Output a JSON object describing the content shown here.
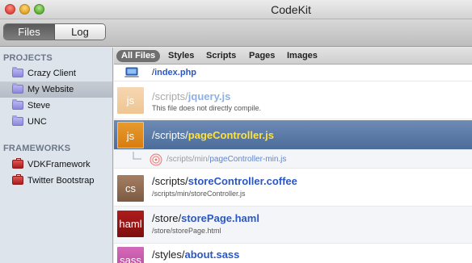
{
  "window": {
    "title": "CodeKit"
  },
  "toolbar": {
    "tabs": [
      "Files",
      "Log"
    ],
    "active_tab": "Files"
  },
  "sidebar": {
    "projects_heading": "PROJECTS",
    "projects": [
      "Crazy Client",
      "My Website",
      "Steve",
      "UNC"
    ],
    "selected_project": "My Website",
    "frameworks_heading": "FRAMEWORKS",
    "frameworks": [
      "VDKFramework",
      "Twitter Bootstrap"
    ]
  },
  "filters": {
    "items": [
      "All Files",
      "Styles",
      "Scripts",
      "Pages",
      "Images"
    ],
    "active": "All Files"
  },
  "files": [
    {
      "dir": "/",
      "name": "index.php",
      "sub": "",
      "icon": "computer-icon"
    },
    {
      "dir": "/scripts/",
      "name": "jquery.js",
      "sub": "This file does not directly compile.",
      "icon": "js",
      "tile": "js"
    },
    {
      "dir": "/scripts/",
      "name": "pageController.js",
      "sub": "",
      "icon": "js",
      "tile": "js",
      "selected": true
    },
    {
      "dir": "/scripts/min/",
      "name": "pageController-min.js",
      "sub": "",
      "icon": "target-icon"
    },
    {
      "dir": "/scripts/",
      "name": "storeController.coffee",
      "sub": "/scripts/min/storeController.js",
      "icon": "cs",
      "tile": "cs"
    },
    {
      "dir": "/store/",
      "name": "storePage.haml",
      "sub": "/store/storePage.html",
      "icon": "haml",
      "tile": "haml"
    },
    {
      "dir": "/styles/",
      "name": "about.sass",
      "sub": "",
      "icon": "sass",
      "tile": "sass"
    }
  ],
  "colors": {
    "selection": "#5778a6",
    "filename": "#2b57c6",
    "selected_filename": "#ffe23a"
  }
}
